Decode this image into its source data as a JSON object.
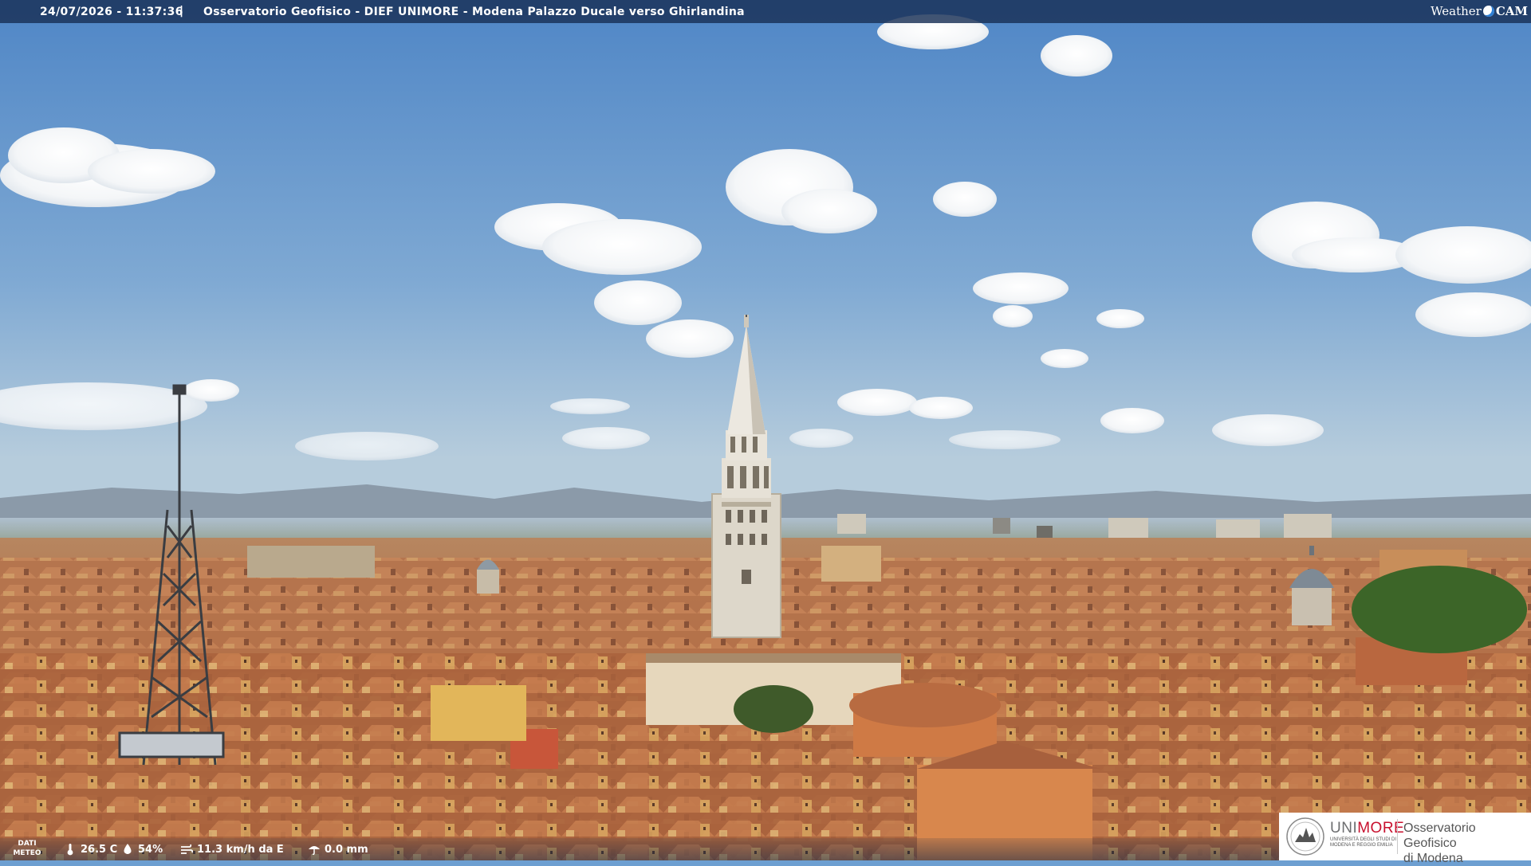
{
  "header": {
    "timestamp": "24/07/2026 - 11:37:36",
    "separator": "|",
    "camera_title": "Osservatorio Geofisico - DIEF UNIMORE - Modena Palazzo Ducale verso Ghirlandina",
    "brand_left": "Weather",
    "brand_right": "CAM"
  },
  "weather": {
    "label_line1": "DATI",
    "label_line2": "METEO",
    "temperature": "26.5 C",
    "humidity": "54%",
    "wind": "11.3 km/h da E",
    "rain": "0.0 mm"
  },
  "logo": {
    "uni_part1": "UNI",
    "uni_part2": "MORE",
    "uni_subtitle": "UNIVERSITÀ DEGLI STUDI DI MODENA E REGGIO EMILIA",
    "observatory_line1": "Osservatorio Geofisico",
    "observatory_line2": "di Modena"
  },
  "colors": {
    "sky_top": "#5b8fcb",
    "sky_bottom": "#a9c6dd",
    "roof": "#b9734a",
    "tower": "#e3ddd0",
    "unimore_red": "#c8102e"
  }
}
